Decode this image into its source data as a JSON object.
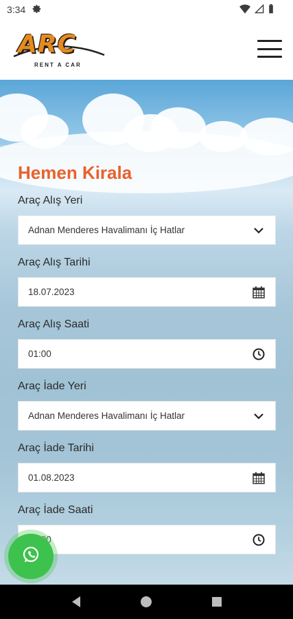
{
  "status_bar": {
    "time": "3:34"
  },
  "header": {
    "logo_text": "ARC",
    "logo_subtitle": "RENT A CAR"
  },
  "form": {
    "title": "Hemen Kirala",
    "fields": [
      {
        "label": "Araç Alış Yeri",
        "value": "Adnan Menderes Havalimanı İç Hatlar",
        "icon": "chevron-down-icon"
      },
      {
        "label": "Araç Alış Tarihi",
        "value": "18.07.2023",
        "icon": "calendar-icon"
      },
      {
        "label": "Araç Alış Saati",
        "value": "01:00",
        "icon": "clock-icon"
      },
      {
        "label": "Araç İade Yeri",
        "value": "Adnan Menderes Havalimanı İç Hatlar",
        "icon": "chevron-down-icon"
      },
      {
        "label": "Araç İade Tarihi",
        "value": "01.08.2023",
        "icon": "calendar-icon"
      },
      {
        "label": "Araç İade Saati",
        "value": "01:00",
        "icon": "clock-icon"
      }
    ]
  },
  "colors": {
    "accent": "#e8612c",
    "whatsapp": "#3cc24d"
  }
}
